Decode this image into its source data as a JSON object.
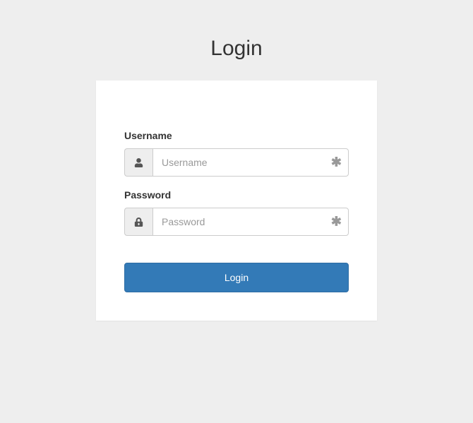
{
  "page": {
    "title": "Login"
  },
  "form": {
    "username": {
      "label": "Username",
      "placeholder": "Username",
      "value": "",
      "required_marker": "✱"
    },
    "password": {
      "label": "Password",
      "placeholder": "Password",
      "value": "",
      "required_marker": "✱"
    },
    "submit_label": "Login"
  },
  "icons": {
    "user": "user-icon",
    "lock": "lock-icon"
  },
  "colors": {
    "background": "#eeeeee",
    "card_bg": "#ffffff",
    "primary": "#337ab7",
    "border": "#cccccc",
    "text": "#333333",
    "placeholder": "#999999"
  }
}
